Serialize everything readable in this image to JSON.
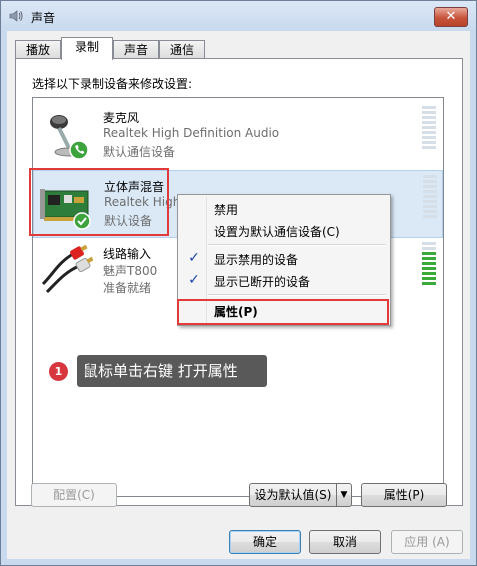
{
  "window": {
    "title": "声音",
    "close_glyph": "✕"
  },
  "tabs": [
    {
      "label": "播放",
      "active": false
    },
    {
      "label": "录制",
      "active": true
    },
    {
      "label": "声音",
      "active": false
    },
    {
      "label": "通信",
      "active": false
    }
  ],
  "instruction": "选择以下录制设备来修改设置:",
  "devices": [
    {
      "name": "麦克风",
      "driver": "Realtek High Definition Audio",
      "status": "默认通信设备",
      "icon": "microphone-icon",
      "badge": "phone-badge"
    },
    {
      "name": "立体声混音",
      "driver": "Realtek High D",
      "status": "默认设备",
      "icon": "sound-card-icon",
      "badge": "checkmark-badge",
      "selected": true
    },
    {
      "name": "线路输入",
      "driver": "魅声T800",
      "status": "准备就绪",
      "icon": "rca-cable-icon",
      "badge": ""
    }
  ],
  "context_menu": {
    "items": [
      {
        "label": "禁用",
        "checked": false
      },
      {
        "label": "设置为默认通信设备(C)",
        "checked": false
      },
      {
        "label": "显示禁用的设备",
        "checked": true
      },
      {
        "label": "显示已断开的设备",
        "checked": true
      },
      {
        "label": "属性(P)",
        "checked": false,
        "bold": true
      }
    ],
    "check_glyph": "✓"
  },
  "callout": {
    "number": "1",
    "text": "鼠标单击右键  打开属性"
  },
  "buttons": {
    "configure": "配置(C)",
    "set_default": "设为默认值(S)",
    "dropdown_glyph": "▼",
    "properties": "属性(P)",
    "ok": "确定",
    "cancel": "取消",
    "apply": "应用 (A)"
  },
  "colors": {
    "highlight_red": "#e03a3a",
    "selected_row": "#dbe9f7",
    "level_green": "#3aab3a",
    "callout_bg": "#595959"
  },
  "line_in_level": 0.8
}
